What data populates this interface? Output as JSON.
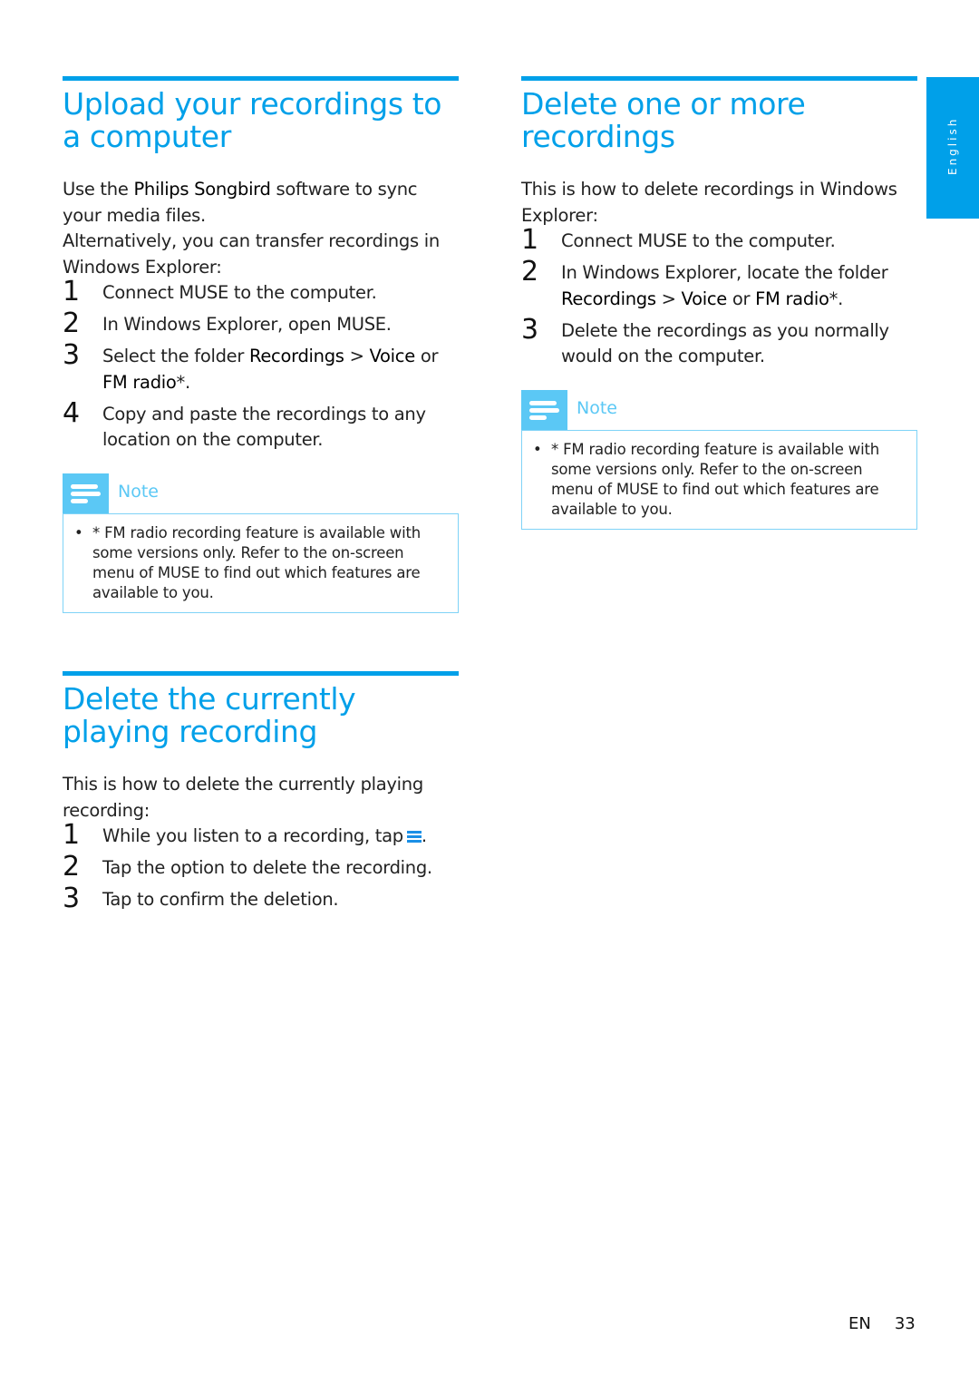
{
  "lang_tab": "English",
  "colors": {
    "accent": "#00a0e9",
    "note": "#5bc8f5",
    "note_border": "#7fd3f7"
  },
  "upload": {
    "title": "Upload your recordings to a computer",
    "intro": [
      [
        "Use the ",
        "Philips Songbird",
        " software to sync your media files."
      ],
      [
        "Alternatively, you can transfer recordings in Windows Explorer:"
      ]
    ],
    "steps": [
      {
        "num": "1",
        "parts": [
          "Connect MUSE to the computer."
        ]
      },
      {
        "num": "2",
        "parts": [
          "In Windows Explorer, open MUSE."
        ]
      },
      {
        "num": "3",
        "parts": [
          "Select the folder ",
          "Recordings",
          " > ",
          "Voice",
          " or ",
          "FM radio",
          "*."
        ]
      },
      {
        "num": "4",
        "parts": [
          "Copy and paste the recordings to any location on the computer."
        ]
      }
    ],
    "note_label": "Note",
    "note_bullet": "•",
    "note_text": "* FM radio recording feature is available with some versions only. Refer to the on-screen menu of MUSE to find out which features are available to you."
  },
  "delete_playing": {
    "title": "Delete the currently playing recording",
    "intro": "This is how to delete the currently playing recording:",
    "steps": [
      {
        "num": "1",
        "text": "While you listen to a recording, tap",
        "icon": "menu-icon",
        "after": "."
      },
      {
        "num": "2",
        "text": "Tap the option to delete the recording."
      },
      {
        "num": "3",
        "text": "Tap to confirm the deletion."
      }
    ]
  },
  "delete_more": {
    "title": "Delete one or more recordings",
    "intro": "This is how to delete recordings in Windows Explorer:",
    "steps": [
      {
        "num": "1",
        "parts": [
          "Connect MUSE to the computer."
        ]
      },
      {
        "num": "2",
        "parts": [
          "In Windows Explorer, locate the folder ",
          "Recordings",
          " > ",
          "Voice",
          " or ",
          "FM radio",
          "*."
        ]
      },
      {
        "num": "3",
        "parts": [
          "Delete the recordings as you normally would on the computer."
        ]
      }
    ],
    "note_label": "Note",
    "note_bullet": "•",
    "note_text": "* FM radio recording feature is available with some versions only. Refer to the on-screen menu of MUSE to find out which features are available to you."
  },
  "footer": {
    "lang": "EN",
    "page": "33"
  }
}
